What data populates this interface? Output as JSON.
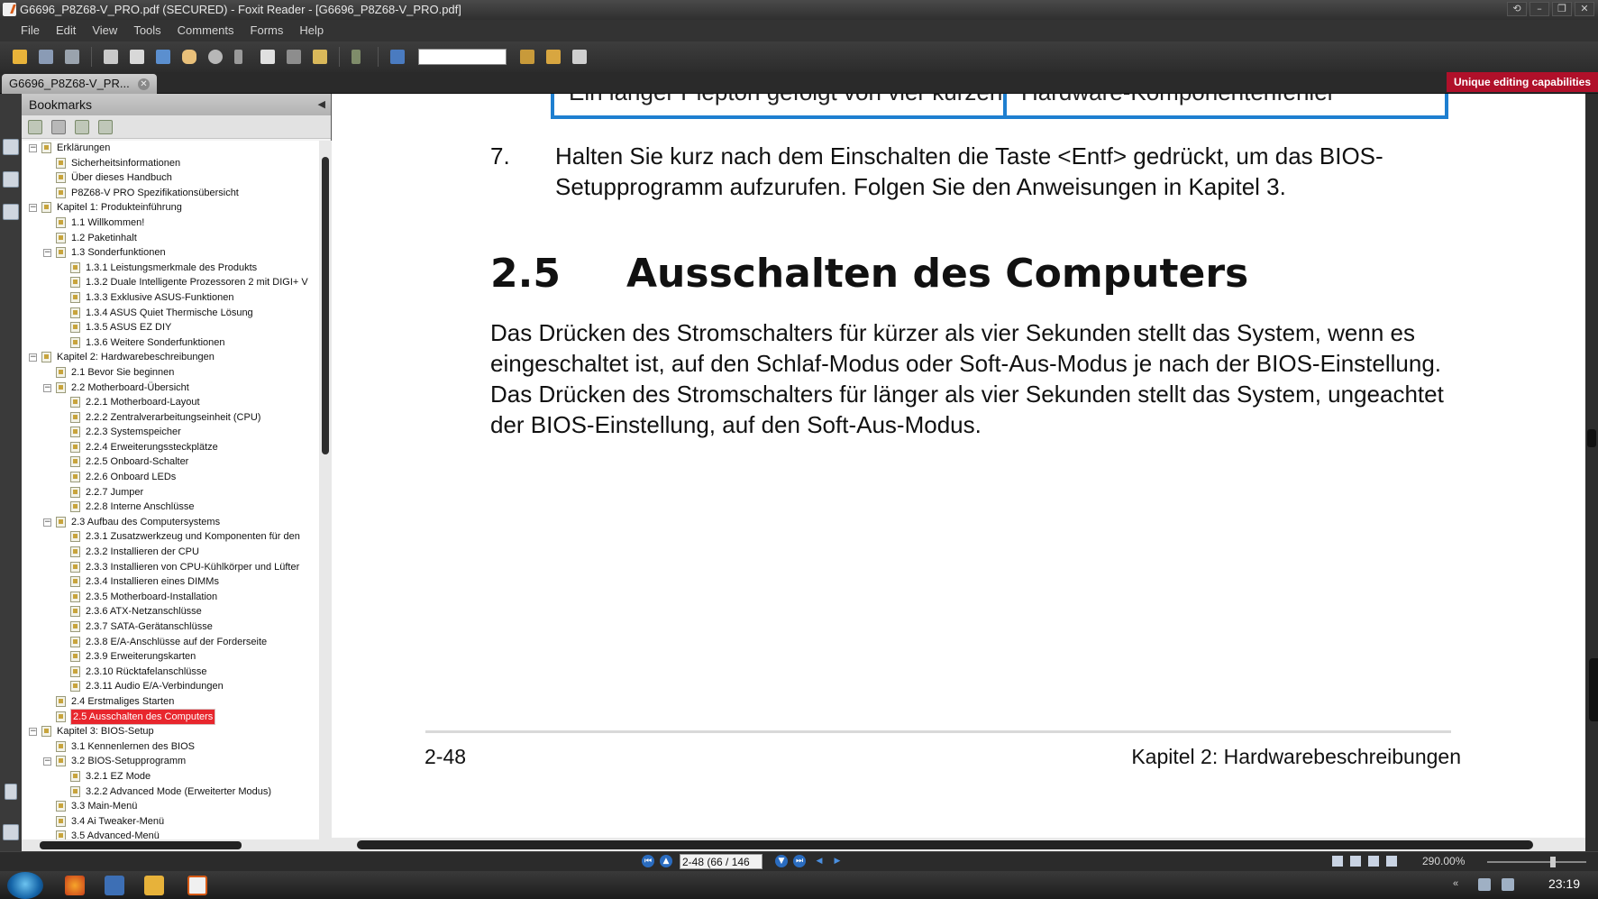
{
  "window": {
    "title": "G6696_P8Z68-V_PRO.pdf (SECURED) - Foxit Reader - [G6696_P8Z68-V_PRO.pdf]",
    "controls": [
      "⟲",
      "–",
      "❐",
      "✕"
    ]
  },
  "menu": [
    "File",
    "Edit",
    "View",
    "Tools",
    "Comments",
    "Forms",
    "Help"
  ],
  "toolbar": {
    "find_value": "",
    "icons": [
      "open-folder-icon",
      "save-icon",
      "save-as-icon",
      "print-icon",
      "email-icon",
      "screen-icon",
      "hand-tool-icon",
      "zoom-tool-icon",
      "select-tool-icon",
      "text-select-icon",
      "snapshot-icon",
      "typewriter-icon",
      "sign-icon",
      "find-icon",
      "find-prev-icon",
      "find-next-icon",
      "export-icon"
    ]
  },
  "tabs": {
    "document_tab": "G6696_P8Z68-V_PR...",
    "promo": "Unique editing capabilities"
  },
  "bookmarks": {
    "header": "Bookmarks",
    "items": [
      {
        "level": 0,
        "exp": "−",
        "label": "Erklärungen"
      },
      {
        "level": 1,
        "exp": "",
        "label": "Sicherheitsinformationen"
      },
      {
        "level": 1,
        "exp": "",
        "label": "Über dieses Handbuch"
      },
      {
        "level": 1,
        "exp": "",
        "label": "P8Z68-V PRO Spezifikationsübersicht"
      },
      {
        "level": 0,
        "exp": "−",
        "label": "Kapitel 1: Produkteinführung"
      },
      {
        "level": 1,
        "exp": "",
        "label": "1.1 Willkommen!"
      },
      {
        "level": 1,
        "exp": "",
        "label": "1.2 Paketinhalt"
      },
      {
        "level": 1,
        "exp": "−",
        "label": "1.3 Sonderfunktionen"
      },
      {
        "level": 2,
        "exp": "",
        "label": "1.3.1 Leistungsmerkmale des Produkts"
      },
      {
        "level": 2,
        "exp": "",
        "label": "1.3.2 Duale Intelligente Prozessoren 2 mit DIGI+ V"
      },
      {
        "level": 2,
        "exp": "",
        "label": "1.3.3 Exklusive ASUS-Funktionen"
      },
      {
        "level": 2,
        "exp": "",
        "label": "1.3.4 ASUS Quiet Thermische Lösung"
      },
      {
        "level": 2,
        "exp": "",
        "label": "1.3.5 ASUS EZ DIY"
      },
      {
        "level": 2,
        "exp": "",
        "label": "1.3.6 Weitere Sonderfunktionen"
      },
      {
        "level": 0,
        "exp": "−",
        "label": "Kapitel 2: Hardwarebeschreibungen"
      },
      {
        "level": 1,
        "exp": "",
        "label": "2.1 Bevor Sie beginnen"
      },
      {
        "level": 1,
        "exp": "−",
        "label": "2.2 Motherboard-Übersicht"
      },
      {
        "level": 2,
        "exp": "",
        "label": "2.2.1 Motherboard-Layout"
      },
      {
        "level": 2,
        "exp": "",
        "label": "2.2.2 Zentralverarbeitungseinheit (CPU)"
      },
      {
        "level": 2,
        "exp": "",
        "label": "2.2.3 Systemspeicher"
      },
      {
        "level": 2,
        "exp": "",
        "label": "2.2.4 Erweiterungssteckplätze"
      },
      {
        "level": 2,
        "exp": "",
        "label": "2.2.5 Onboard-Schalter"
      },
      {
        "level": 2,
        "exp": "",
        "label": "2.2.6 Onboard LEDs"
      },
      {
        "level": 2,
        "exp": "",
        "label": "2.2.7 Jumper"
      },
      {
        "level": 2,
        "exp": "",
        "label": "2.2.8 Interne Anschlüsse"
      },
      {
        "level": 1,
        "exp": "−",
        "label": "2.3 Aufbau des Computersystems"
      },
      {
        "level": 2,
        "exp": "",
        "label": "2.3.1 Zusatzwerkzeug und Komponenten für den"
      },
      {
        "level": 2,
        "exp": "",
        "label": "2.3.2 Installieren der CPU"
      },
      {
        "level": 2,
        "exp": "",
        "label": "2.3.3 Installieren von CPU-Kühlkörper und Lüfter"
      },
      {
        "level": 2,
        "exp": "",
        "label": "2.3.4 Installieren eines DIMMs"
      },
      {
        "level": 2,
        "exp": "",
        "label": "2.3.5 Motherboard-Installation"
      },
      {
        "level": 2,
        "exp": "",
        "label": "2.3.6 ATX-Netzanschlüsse"
      },
      {
        "level": 2,
        "exp": "",
        "label": "2.3.7 SATA-Gerätanschlüsse"
      },
      {
        "level": 2,
        "exp": "",
        "label": "2.3.8 E/A-Anschlüsse auf der Forderseite"
      },
      {
        "level": 2,
        "exp": "",
        "label": "2.3.9 Erweiterungskarten"
      },
      {
        "level": 2,
        "exp": "",
        "label": "2.3.10 Rücktafelanschlüsse"
      },
      {
        "level": 2,
        "exp": "",
        "label": "2.3.11 Audio E/A-Verbindungen"
      },
      {
        "level": 1,
        "exp": "",
        "label": "2.4 Erstmaliges Starten"
      },
      {
        "level": 1,
        "exp": "",
        "label": "2.5 Ausschalten des Computers",
        "selected": true
      },
      {
        "level": 0,
        "exp": "−",
        "label": "Kapitel 3: BIOS-Setup"
      },
      {
        "level": 1,
        "exp": "",
        "label": "3.1 Kennenlernen des BIOS"
      },
      {
        "level": 1,
        "exp": "−",
        "label": "3.2 BIOS-Setupprogramm"
      },
      {
        "level": 2,
        "exp": "",
        "label": "3.2.1 EZ Mode"
      },
      {
        "level": 2,
        "exp": "",
        "label": "3.2.2 Advanced Mode (Erweiterter Modus)"
      },
      {
        "level": 1,
        "exp": "",
        "label": "3.3 Main-Menü"
      },
      {
        "level": 1,
        "exp": "",
        "label": "3.4 Ai Tweaker-Menü"
      },
      {
        "level": 1,
        "exp": "",
        "label": "3.5 Advanced-Menü"
      }
    ]
  },
  "document": {
    "frame_text_left": "Ein langer Piepton gefolgt von vier kurzen",
    "frame_text_right": "Hardware-Komponentenfehler",
    "step_number": "7.",
    "step_text": "Halten Sie kurz nach dem Einschalten die Taste <Entf> gedrückt, um das BIOS-Setupprogramm aufzurufen. Folgen Sie den Anweisungen in Kapitel 3.",
    "section_number": "2.5",
    "section_title": "Ausschalten des Computers",
    "section_body": "Das Drücken des Stromschalters für kürzer als vier Sekunden stellt das System, wenn es eingeschaltet ist, auf den Schlaf-Modus oder Soft-Aus-Modus je nach der BIOS-Einstellung. Das Drücken des Stromschalters für länger als vier Sekunden stellt das System, ungeachtet der BIOS-Einstellung, auf den Soft-Aus-Modus.",
    "page_number": "2-48",
    "footer_chapter": "Kapitel 2: Hardwarebeschreibungen"
  },
  "status": {
    "page_field": "2-48 (66 / 146",
    "zoom": "290.00%"
  },
  "taskbar": {
    "time": "23:19"
  }
}
